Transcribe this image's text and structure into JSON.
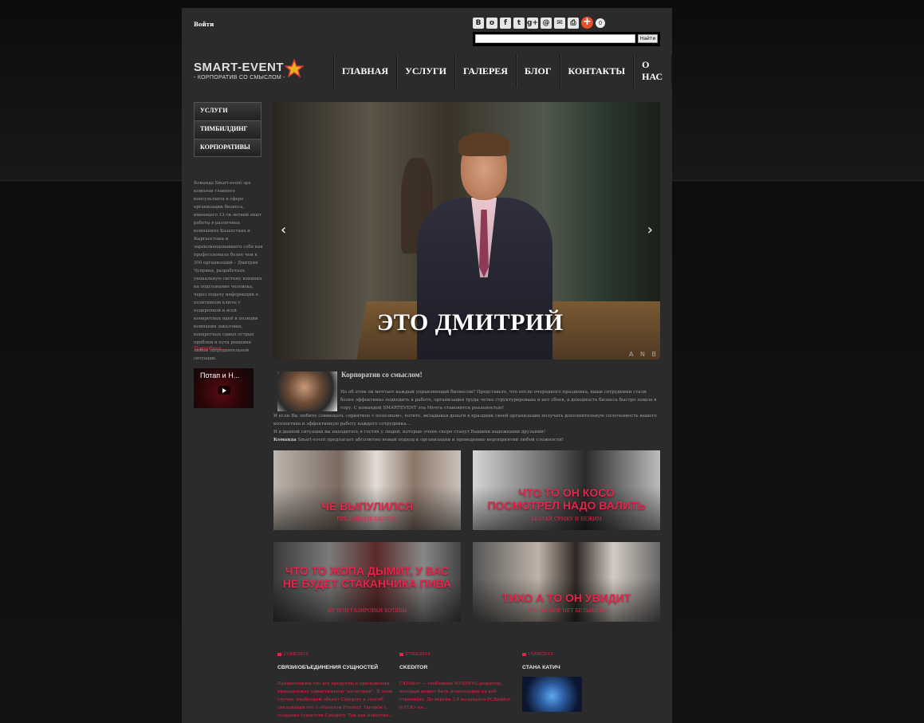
{
  "header": {
    "login": "Войти",
    "share_icons": [
      "vk-icon",
      "odnoklassniki-icon",
      "facebook-icon",
      "twitter-icon",
      "googleplus-icon",
      "mailru-icon",
      "email-icon",
      "print-icon"
    ],
    "share_labels": [
      "В",
      "о",
      "f",
      "t",
      "g+",
      "@",
      "✉",
      "⎙"
    ],
    "share_count": "0",
    "search_placeholder": "",
    "search_button": "Найти"
  },
  "logo": {
    "name": "SMART-EVENT",
    "tagline": "- КОРПОРАТИВ СО СМЫСЛОМ -"
  },
  "nav": [
    "ГЛАВНАЯ",
    "УСЛУГИ",
    "ГАЛЕРЕЯ",
    "БЛОГ",
    "КОНТАКТЫ",
    "О НАС"
  ],
  "left_menu": [
    "УСЛУГИ",
    "ТИМБИЛДИНГ",
    "КОРПОРАТИВЫ"
  ],
  "left_text": "Команда Smart-event  эрх комплан главного консультанта в сфере организации бизнеса, имеющего 13-ти летний опыт работы в различных компаниях Казахстана и Кыргызстана и зарекомендовавшего себя как профессионала более чем в 300 организаций – Дмитрия Чуприна, разработала уникальную систему влияния на подсознание человека, через подачу информации в позитивном ключе с подкрепкой и всей конкретных идей и позиции компании заказчика, конкретных самых острых проблем и пути решения любой затруднительной ситуации.",
  "left_more": "Подробнее...",
  "video": {
    "title": "Потап и Н..."
  },
  "slider": {
    "caption": "ЭТО ДМИТРИЙ",
    "watermark": "A N B",
    "prev": "‹",
    "next": "›"
  },
  "article": {
    "title": "Корпоратив со смыслом!",
    "text1": "Не об этом ли мечтает каждый управляющий бизнесом? Представьте, что после очередного праздника, ваши сотрудники стали более эффективно подходить к работе, организация труда четко структурирована и нет сбоев, а доходность бизнеса быстро пошла в гору. С командой SMARTEVENT эта Мечта становится реальностью!",
    "text2": "И если Вы любите совмещать «приятное с полезным», хотите, вкладывая деньги в праздник своей организации получать дополнительную сплоченность вашего коллектива и эффективную работу каждого сотрудника…",
    "text3": "И в данной ситуации вы находитесь в гостях у людей, которые очень скоро станут Вашими надежными друзьями!",
    "text4_bold": "Команда",
    "text4": " Smart-event предлагает абсолютно новый подход к организации и проведению мероприятий любой сложности!"
  },
  "tiles": [
    {
      "title": "ЧЕ ВЫПУЛИЛСЯ",
      "sub": "ПРЕДЬЯВИТЕ БИЛЕТЫ"
    },
    {
      "title": "ЧТО ТО ОН КОСО ПОСМОТРЕЛ НАДО ВАЛИТЬ",
      "sub": "ХВАТАЙ СУМКУ И БЕЖИМ"
    },
    {
      "title": "ЧТО ТО ЖОПА ДЫМИТ, У ВАС НЕ БУДЕТ СТАКАНЧИКА ПИВА",
      "sub": "НУ ИЛИ ГАЗИРОВКИ ХОТЯБЫ"
    },
    {
      "title": "ТИХО А ТО ОН УВИДИТ",
      "sub": "ЧТО НА МНЕ НЕТ БЕЛЬИШКА"
    }
  ],
  "news": [
    {
      "date": "27/08/2015",
      "title": "СВЯЗИ/ОБЪЕДИНЕНИЯ СУЩНОСТЕЙ",
      "text": "Предположим что все продукты в приложении принадлежат единственной \"категории\". В этом случае, необходим объект Category и способ связывания его с объектом Product. Начнём с создания сущности Category. Так как известно..."
    },
    {
      "date": "27/08/2015",
      "title": "CKEDITOR",
      "text": "CKEditor — свободный WYSIWYG-редактор, который может быть использован на веб-страницах. До версии 3.0 назывался FCKeditor (eFCK» не..."
    },
    {
      "date": "15/08/2015",
      "title": "СТАНА КАТИЧ",
      "text": ""
    }
  ]
}
